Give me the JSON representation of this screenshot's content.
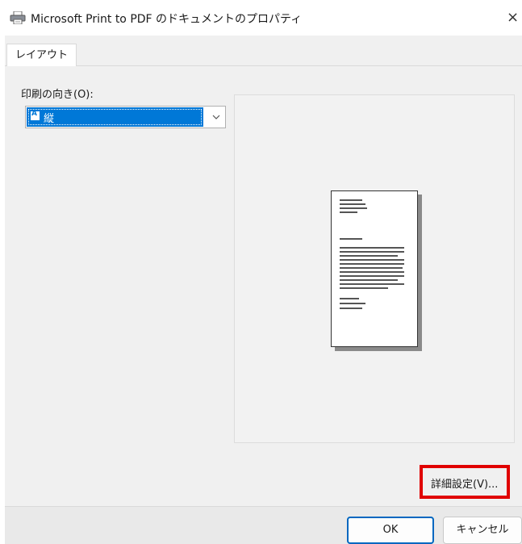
{
  "window": {
    "title": "Microsoft Print to PDF のドキュメントのプロパティ",
    "icon": "printer-icon",
    "close_label": "×"
  },
  "tabs": [
    {
      "label": "レイアウト",
      "selected": true
    }
  ],
  "layout": {
    "orientation_label": "印刷の向き(O):",
    "orientation_value": "縦",
    "orientation_icon": "portrait-page-icon",
    "preview_icon": "document-preview-icon",
    "advanced_button_label": "詳細設定(V)..."
  },
  "footer": {
    "ok_label": "OK",
    "cancel_label": "キャンセル"
  },
  "colors": {
    "selection": "#0078d7",
    "highlight_box": "#e00000",
    "default_button_border": "#0067c0"
  }
}
